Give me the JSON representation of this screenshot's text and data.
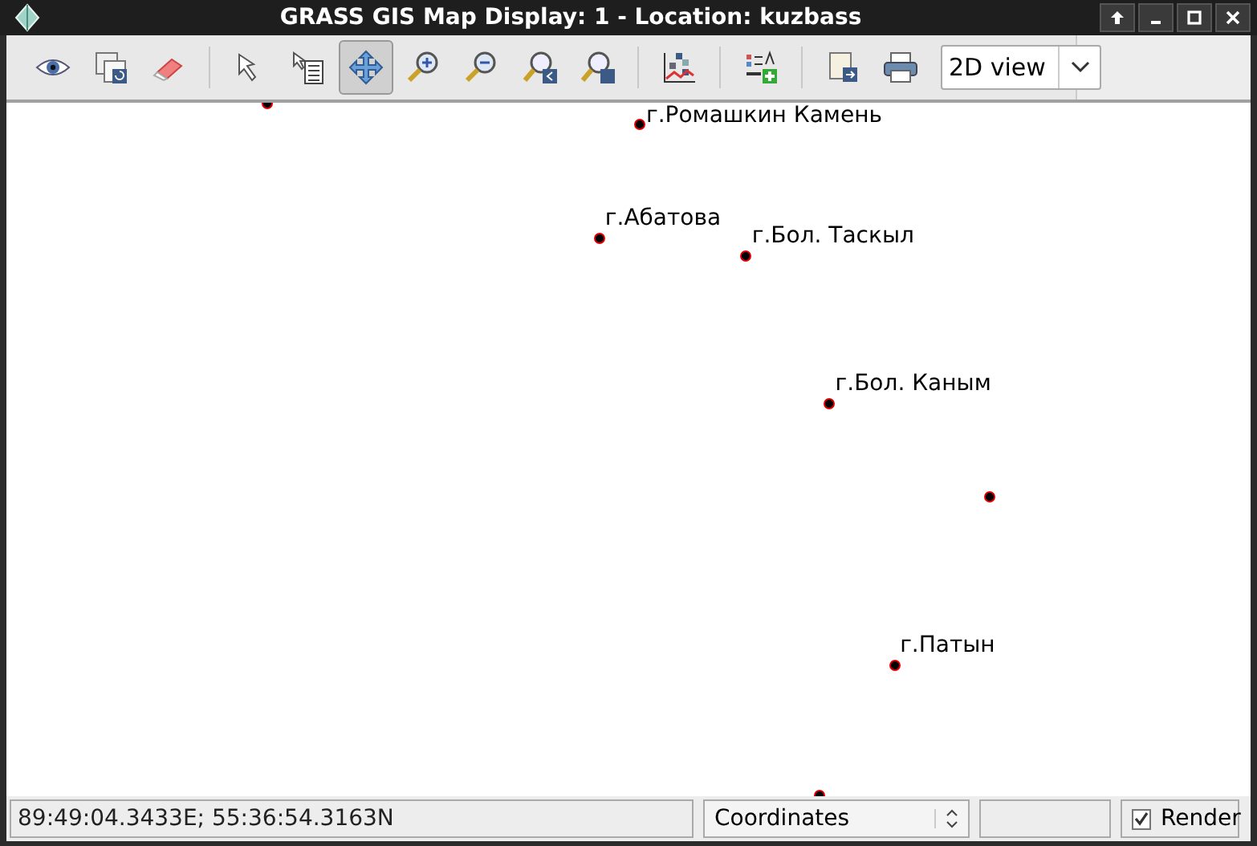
{
  "window": {
    "title": "GRASS GIS Map Display: 1 - Location: kuzbass"
  },
  "toolbar": {
    "tools": [
      {
        "kind": "eye",
        "selected": false
      },
      {
        "kind": "render",
        "selected": false
      },
      {
        "kind": "erase",
        "selected": false
      },
      {
        "kind": "sep"
      },
      {
        "kind": "pointer",
        "selected": false
      },
      {
        "kind": "query",
        "selected": false
      },
      {
        "kind": "pan",
        "selected": true
      },
      {
        "kind": "zoomin",
        "selected": false
      },
      {
        "kind": "zoomout",
        "selected": false
      },
      {
        "kind": "zoomback",
        "selected": false
      },
      {
        "kind": "zoommenu",
        "selected": false
      },
      {
        "kind": "sep"
      },
      {
        "kind": "analyze",
        "selected": false
      },
      {
        "kind": "sep"
      },
      {
        "kind": "decoration",
        "selected": false
      },
      {
        "kind": "sep"
      },
      {
        "kind": "save",
        "selected": false
      },
      {
        "kind": "print",
        "selected": false
      }
    ],
    "view_mode": "2D view"
  },
  "map": {
    "points": [
      {
        "label": "г.Ромашкин Камень"
      },
      {
        "label": "г.Абатова"
      },
      {
        "label": "г.Бол. Таскыл"
      },
      {
        "label": "г.Бол. Каным"
      },
      {
        "label": "г.Патын"
      }
    ]
  },
  "status_bar": {
    "coordinates": "89:49:04.3433E; 55:36:54.3163N",
    "mode": "Coordinates",
    "render": {
      "label": "Render",
      "checked": true
    }
  }
}
